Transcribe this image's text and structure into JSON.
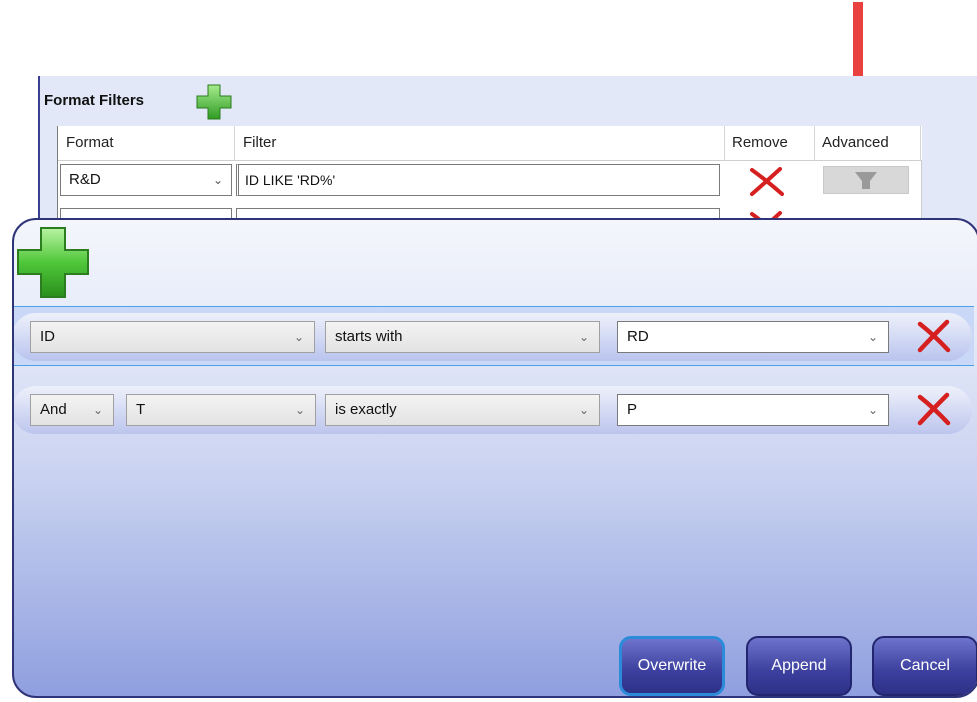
{
  "colors": {
    "annotation_arrow": "#e8413f",
    "dialog_border": "#2f3378",
    "button_blue": "#3c3f9d",
    "remove_red": "#d62020",
    "add_green": "#3fbf2f"
  },
  "format_filters": {
    "title": "Format Filters",
    "add_icon": "plus-icon",
    "columns": [
      "Format",
      "Filter",
      "Remove",
      "Advanced"
    ],
    "rows": [
      {
        "format": "R&D",
        "filter": "ID LIKE 'RD%'",
        "remove_icon": "close-icon",
        "advanced_icon": "funnel-icon"
      },
      {
        "format": "",
        "filter": "",
        "remove_icon": "close-icon",
        "advanced_icon": "funnel-icon"
      }
    ]
  },
  "advanced_dialog": {
    "add_icon": "plus-icon",
    "conditions": [
      {
        "field": "ID",
        "operator": "starts with",
        "value": "RD",
        "selected": true
      },
      {
        "connector": "And",
        "field": "T",
        "operator": "is exactly",
        "value": "P",
        "selected": false
      }
    ],
    "buttons": {
      "overwrite": "Overwrite",
      "append": "Append",
      "cancel": "Cancel"
    }
  }
}
